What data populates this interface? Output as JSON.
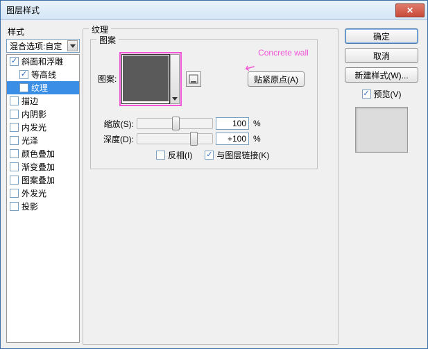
{
  "title": "图层样式",
  "left": {
    "styles_label": "样式",
    "blend_combo": "混合选项:自定",
    "items": [
      {
        "label": "斜面和浮雕",
        "checked": true,
        "selected": false,
        "indent": false
      },
      {
        "label": "等高线",
        "checked": true,
        "selected": false,
        "indent": true
      },
      {
        "label": "纹理",
        "checked": true,
        "selected": true,
        "indent": true
      },
      {
        "label": "描边",
        "checked": false,
        "selected": false,
        "indent": false
      },
      {
        "label": "内阴影",
        "checked": false,
        "selected": false,
        "indent": false
      },
      {
        "label": "内发光",
        "checked": false,
        "selected": false,
        "indent": false
      },
      {
        "label": "光泽",
        "checked": false,
        "selected": false,
        "indent": false
      },
      {
        "label": "颜色叠加",
        "checked": false,
        "selected": false,
        "indent": false
      },
      {
        "label": "渐变叠加",
        "checked": false,
        "selected": false,
        "indent": false
      },
      {
        "label": "图案叠加",
        "checked": false,
        "selected": false,
        "indent": false
      },
      {
        "label": "外发光",
        "checked": false,
        "selected": false,
        "indent": false
      },
      {
        "label": "投影",
        "checked": false,
        "selected": false,
        "indent": false
      }
    ]
  },
  "center": {
    "outer_title": "纹理",
    "inner_title": "图案",
    "pattern_label": "图案:",
    "snap_origin": "贴紧原点(A)",
    "annotation": "Concrete wall",
    "scale_label": "缩放(S):",
    "scale_value": "100",
    "scale_pct": "%",
    "depth_label": "深度(D):",
    "depth_value": "+100",
    "depth_pct": "%",
    "invert_label": "反相(I)",
    "invert_checked": false,
    "link_label": "与图层链接(K)",
    "link_checked": true
  },
  "right": {
    "ok": "确定",
    "cancel": "取消",
    "new_style": "新建样式(W)...",
    "preview_label": "预览(V)",
    "preview_checked": true
  }
}
